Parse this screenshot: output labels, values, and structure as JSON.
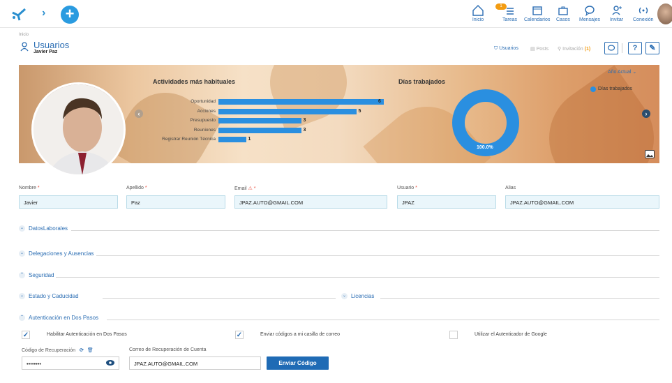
{
  "topbar": {
    "nav": [
      {
        "label": "Inicio",
        "icon": "home-icon"
      },
      {
        "label": "Tareas",
        "icon": "tasks-icon",
        "badge": "1"
      },
      {
        "label": "Calendarios",
        "icon": "calendar-icon"
      },
      {
        "label": "Casos",
        "icon": "briefcase-icon"
      },
      {
        "label": "Mensajes",
        "icon": "chat-icon"
      },
      {
        "label": "Invitar",
        "icon": "invite-user-icon"
      },
      {
        "label": "Conexión",
        "icon": "connection-icon"
      }
    ]
  },
  "header": {
    "breadcrumb": "Inicio",
    "title": "Usuarios",
    "subtitle": "Javier Paz",
    "links": {
      "usuarios": "Usuarios",
      "posts": "Posts",
      "invitacion": "Invitación",
      "invitacion_count": "(1)"
    },
    "help": "?"
  },
  "banner": {
    "activities_title": "Actividades más habituales",
    "days_title": "Días trabajados",
    "year_select": "Año Actual",
    "legend": "Días trabajados",
    "donut_label": "100.0%"
  },
  "chart_data": [
    {
      "type": "bar",
      "title": "Actividades más habituales",
      "categories": [
        "Oportunidad",
        "Acciones",
        "Presupuesto",
        "Reuniones",
        "Registrar Reunión Técnica"
      ],
      "values": [
        6,
        5,
        3,
        3,
        1
      ],
      "xlim": [
        0,
        6
      ]
    },
    {
      "type": "pie",
      "title": "Días trabajados",
      "categories": [
        "Días trabajados"
      ],
      "values": [
        100.0
      ],
      "color": "#2a8fe0"
    }
  ],
  "form": {
    "nombre": {
      "label": "Nombre",
      "value": "Javier"
    },
    "apellido": {
      "label": "Apellido",
      "value": "Paz"
    },
    "email": {
      "label": "Email",
      "value": "JPAZ.AUTO@GMAIL.COM"
    },
    "usuario": {
      "label": "Usuario",
      "value": "JPAZ"
    },
    "alias": {
      "label": "Alias",
      "value": "JPAZ.AUTO@GMAIL.COM"
    },
    "required_mark": "*"
  },
  "sections": {
    "datos_laborales": "DatosLaborales",
    "delegaciones": "Delegaciones y Ausencias",
    "seguridad": "Seguridad",
    "estado": "Estado y Caducidad",
    "licencias": "Licencias",
    "dos_pasos": "Autenticación en Dos Pasos"
  },
  "two_factor": {
    "habilitar": {
      "label": "Habilitar Autenticación en Dos Pasos",
      "checked": true
    },
    "enviar_codigos": {
      "label": "Enviar códigos a mi casilla de correo",
      "checked": true
    },
    "google_auth": {
      "label": "Utilizar el Autenticador de Google",
      "checked": false
    },
    "codigo_label": "Código de Recuperación",
    "codigo_value": "••••••••",
    "correo_label": "Correo de Recuperación de Cuenta",
    "correo_value": "JPAZ.AUTO@GMAIL.COM",
    "send_button": "Enviar Código"
  },
  "colors": {
    "accent": "#2a6db3",
    "bar": "#2a8fe0",
    "button": "#1f6bb5"
  }
}
